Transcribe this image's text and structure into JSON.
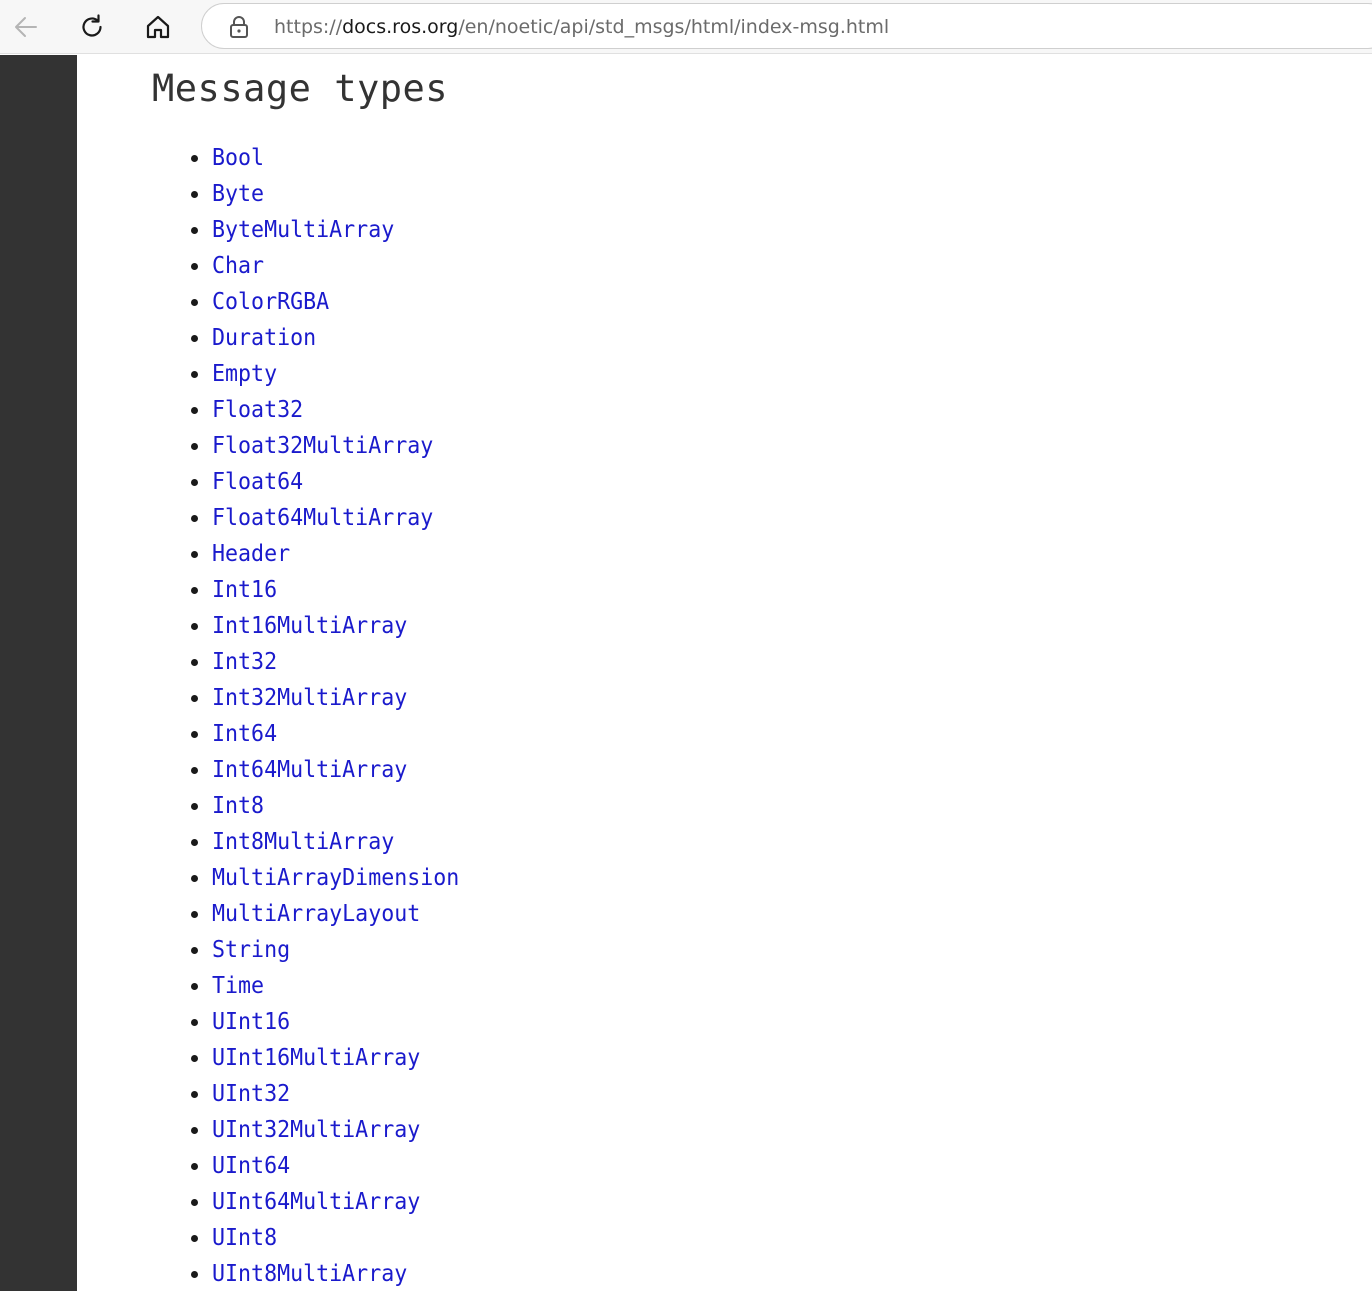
{
  "browser": {
    "url_scheme": "https://",
    "url_host": "docs.ros.org",
    "url_path": "/en/noetic/api/std_msgs/html/index-msg.html",
    "back_icon": "arrow-left-icon",
    "reload_icon": "reload-icon",
    "home_icon": "home-icon",
    "lock_icon": "lock-icon"
  },
  "page": {
    "title": "Message types"
  },
  "messages": [
    "Bool",
    "Byte",
    "ByteMultiArray",
    "Char",
    "ColorRGBA",
    "Duration",
    "Empty",
    "Float32",
    "Float32MultiArray",
    "Float64",
    "Float64MultiArray",
    "Header",
    "Int16",
    "Int16MultiArray",
    "Int32",
    "Int32MultiArray",
    "Int64",
    "Int64MultiArray",
    "Int8",
    "Int8MultiArray",
    "MultiArrayDimension",
    "MultiArrayLayout",
    "String",
    "Time",
    "UInt16",
    "UInt16MultiArray",
    "UInt32",
    "UInt32MultiArray",
    "UInt64",
    "UInt64MultiArray",
    "UInt8",
    "UInt8MultiArray"
  ],
  "colors": {
    "link": "#1a1acc",
    "sidebar": "#333333",
    "title": "#333333"
  }
}
